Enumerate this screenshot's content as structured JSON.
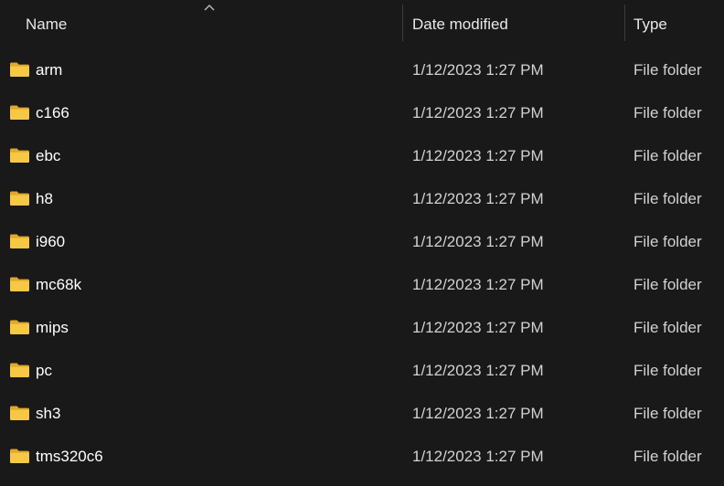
{
  "columns": {
    "name": "Name",
    "date_modified": "Date modified",
    "type": "Type"
  },
  "sort": {
    "column": "name",
    "direction": "ascending",
    "icon": "chevron-up-icon"
  },
  "colors": {
    "background": "#191919",
    "folder": "#f3c13a",
    "divider": "#3c3c3c"
  },
  "items": [
    {
      "name": "arm",
      "date": "1/12/2023 1:27 PM",
      "type": "File folder",
      "icon": "folder-icon"
    },
    {
      "name": "c166",
      "date": "1/12/2023 1:27 PM",
      "type": "File folder",
      "icon": "folder-icon"
    },
    {
      "name": "ebc",
      "date": "1/12/2023 1:27 PM",
      "type": "File folder",
      "icon": "folder-icon"
    },
    {
      "name": "h8",
      "date": "1/12/2023 1:27 PM",
      "type": "File folder",
      "icon": "folder-icon"
    },
    {
      "name": "i960",
      "date": "1/12/2023 1:27 PM",
      "type": "File folder",
      "icon": "folder-icon"
    },
    {
      "name": "mc68k",
      "date": "1/12/2023 1:27 PM",
      "type": "File folder",
      "icon": "folder-icon"
    },
    {
      "name": "mips",
      "date": "1/12/2023 1:27 PM",
      "type": "File folder",
      "icon": "folder-icon"
    },
    {
      "name": "pc",
      "date": "1/12/2023 1:27 PM",
      "type": "File folder",
      "icon": "folder-icon"
    },
    {
      "name": "sh3",
      "date": "1/12/2023 1:27 PM",
      "type": "File folder",
      "icon": "folder-icon"
    },
    {
      "name": "tms320c6",
      "date": "1/12/2023 1:27 PM",
      "type": "File folder",
      "icon": "folder-icon"
    }
  ]
}
